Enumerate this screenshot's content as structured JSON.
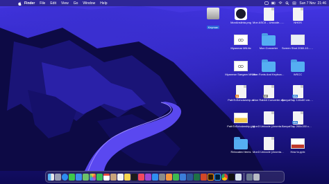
{
  "menubar": {
    "app": "Finder",
    "items": [
      "File",
      "Edit",
      "View",
      "Go",
      "Window",
      "Help"
    ],
    "clock": "Sun 7 Nov  21:46"
  },
  "desktop_icons": [
    {
      "label": "Keyman",
      "kind": "drive",
      "selected": true
    },
    {
      "label": "MonAnsiinta.png",
      "kind": "logo"
    },
    {
      "label": "Mon ASCII – Unicode....rter.html",
      "kind": "doc"
    },
    {
      "label": "NHOS",
      "kind": "doc"
    },
    {
      "label": "Myanmar MN.ttc",
      "kind": "font"
    },
    {
      "label": "Mon Converter",
      "kind": "folder"
    },
    {
      "label": "Screen Shot 2060-10...09.57.10",
      "kind": "shot"
    },
    {
      "label": "Myanmar Sangam MN.ttc",
      "kind": "font"
    },
    {
      "label": "Mon Fonts And Keyboar...r macOS",
      "kind": "folder"
    },
    {
      "label": "WSCC",
      "kind": "folder"
    },
    {
      "label": "PathToScholarship.ai",
      "kind": "doc"
    },
    {
      "label": "Mon Rabbit Converter.zip",
      "kind": "doc"
    },
    {
      "label": "BanyaiSap 140x80 cm.jpg",
      "kind": "doc"
    },
    {
      "label": "PathToScholarship.jpg",
      "kind": "img"
    },
    {
      "label": "Mon3 Unicode (Anonta...ondle",
      "kind": "doc"
    },
    {
      "label": "BanyaiSap 260x150 cm.jpg",
      "kind": "doc"
    },
    {
      "label": "Relocated Items",
      "kind": "folder"
    },
    {
      "label": "Mon3 Unicode (Anonta...layout",
      "kind": "doc"
    },
    {
      "label": "How to.pptx",
      "kind": "doc"
    }
  ],
  "dock": {
    "apps": [
      "finder",
      "launchpad",
      "safari",
      "messages",
      "mail",
      "maps",
      "photos",
      "facetime",
      "calendar",
      "contacts",
      "reminders",
      "notes",
      "tv",
      "music",
      "podcasts",
      "app-store",
      "system-preferences",
      "pages",
      "numbers",
      "keynote",
      "word",
      "excel",
      "powerpoint",
      "illustrator",
      "photoshop",
      "chrome",
      "terminal",
      "preview"
    ]
  }
}
